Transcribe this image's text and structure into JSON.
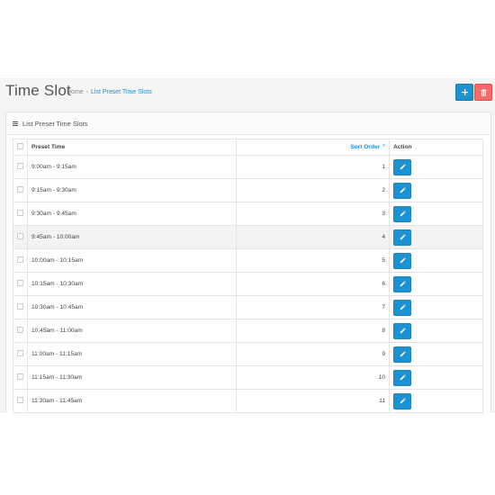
{
  "header": {
    "title": "Time Slot",
    "breadcrumb": [
      {
        "label": "Home"
      },
      {
        "label": "List Preset Time Slots"
      }
    ],
    "add_icon": "plus",
    "delete_icon": "trash"
  },
  "panel": {
    "icon": "list-icon",
    "title": "List Preset Time Slots"
  },
  "table": {
    "columns": {
      "preset_time": "Preset Time",
      "sort_order": "Sort Order",
      "sort_caret": "^",
      "action": "Action"
    },
    "rows": [
      {
        "preset_time": "9:00am - 9:15am",
        "sort_order": "1"
      },
      {
        "preset_time": "9:15am - 9:30am",
        "sort_order": "2"
      },
      {
        "preset_time": "9:30am - 9:45am",
        "sort_order": "3"
      },
      {
        "preset_time": "9:45am - 10:00am",
        "sort_order": "4"
      },
      {
        "preset_time": "10:00am - 10:15am",
        "sort_order": "5"
      },
      {
        "preset_time": "10:15am - 10:30am",
        "sort_order": "6"
      },
      {
        "preset_time": "10:30am - 10:45am",
        "sort_order": "7"
      },
      {
        "preset_time": "10:45am - 11:00am",
        "sort_order": "8"
      },
      {
        "preset_time": "11:00am - 11:15am",
        "sort_order": "9"
      },
      {
        "preset_time": "11:15am - 11:30am",
        "sort_order": "10"
      },
      {
        "preset_time": "11:30am - 11:45am",
        "sort_order": "11"
      }
    ]
  },
  "colors": {
    "primary": "#1e91cf",
    "danger": "#f56b6b",
    "row_highlight": "#f3f3f3"
  }
}
